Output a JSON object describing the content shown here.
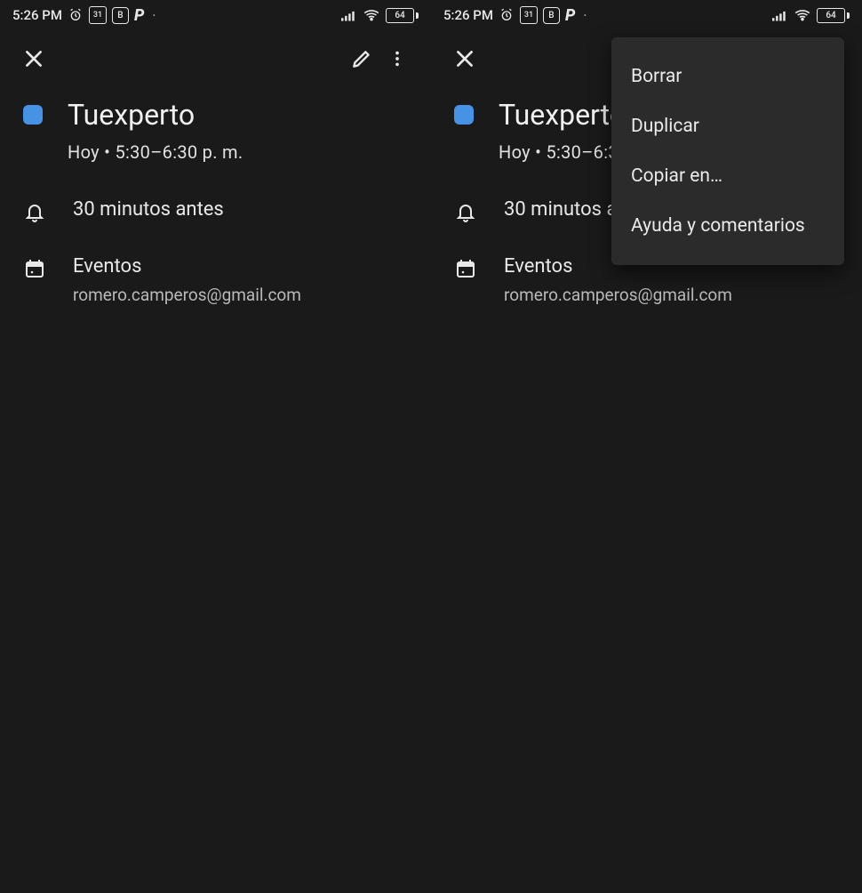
{
  "status": {
    "time": "5:26 PM",
    "date_box": "31",
    "b_box": "B",
    "battery": "64"
  },
  "appbar": {
    "close_name": "close-icon",
    "edit_name": "pencil-icon",
    "more_name": "more-vert-icon"
  },
  "event": {
    "color": "#4693e6",
    "title": "Tuexperto",
    "subtitle": "Hoy  •  5:30–6:30 p. m."
  },
  "reminder": {
    "text": "30 minutos antes"
  },
  "calendar": {
    "label": "Eventos",
    "account": "romero.camperos@gmail.com"
  },
  "menu": {
    "items": [
      "Borrar",
      "Duplicar",
      "Copiar en…",
      "Ayuda y comentarios"
    ]
  }
}
